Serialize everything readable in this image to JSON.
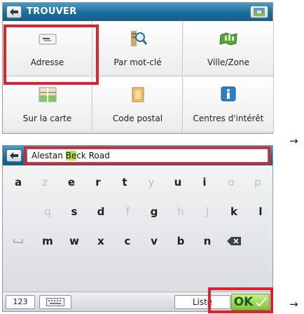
{
  "find_screen": {
    "title": "TROUVER",
    "items": [
      {
        "label": "Adresse",
        "icon": "address-card-icon"
      },
      {
        "label": "Par mot-clé",
        "icon": "keyword-search-icon"
      },
      {
        "label": "Ville/Zone",
        "icon": "city-zone-icon"
      },
      {
        "label": "Sur la carte",
        "icon": "map-icon"
      },
      {
        "label": "Code postal",
        "icon": "postal-code-icon"
      },
      {
        "label": "Centres d'intérêt",
        "icon": "info-icon"
      }
    ]
  },
  "keyboard_screen": {
    "search": {
      "before": "Alestan ",
      "highlight": "Be",
      "after": "ck Road"
    },
    "rows": [
      [
        "a",
        "z",
        "e",
        "r",
        "t",
        "y",
        "u",
        "i",
        "o",
        "p"
      ],
      [
        "q",
        "s",
        "d",
        "f",
        "g",
        "h",
        "j",
        "k",
        "l"
      ],
      [
        "m",
        "w",
        "x",
        "c",
        "v",
        "b",
        "n"
      ]
    ],
    "bottom": {
      "numbers_label": "123",
      "list_label": "Liste",
      "ok_label": "OK"
    }
  },
  "flow_arrow": "→",
  "colors": {
    "titlebar_blue": "#1b6c9a",
    "highlight_red": "#e0222e",
    "ok_green": "#7cc23a",
    "text_highlight": "#b9e04a"
  }
}
